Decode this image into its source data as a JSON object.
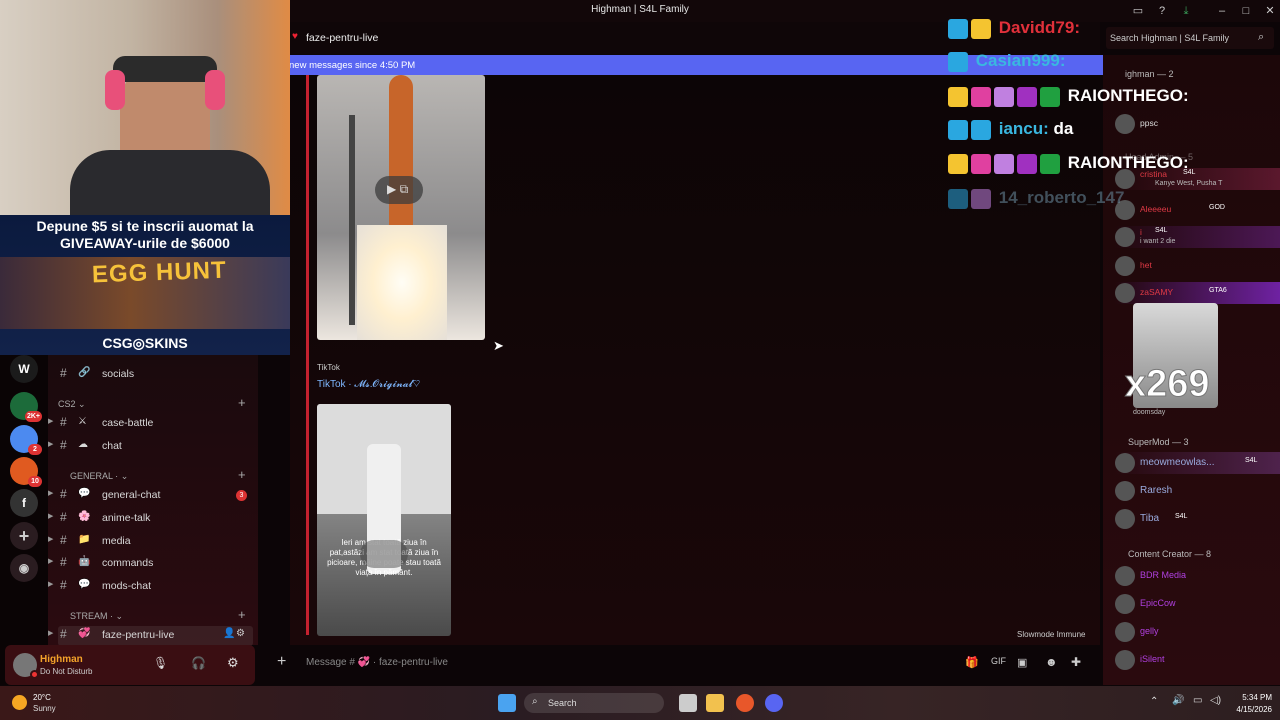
{
  "window": {
    "title": "Highman | S4L Family"
  },
  "promo": {
    "line1": "Depune $5 si te inscrii auomat la",
    "line2": "GIVEAWAY-urile de $6000",
    "event": "EGG HUNT",
    "brand": "CSG◎SKINS"
  },
  "chat_header": {
    "channel": "faze-pentru-live",
    "search_placeholder": "Search Highman | S4L Family"
  },
  "new_messages": {
    "text": "new messages since 4:50 PM"
  },
  "embed": {
    "provider": "TikTok",
    "author": "TikTok · 𝓜𝓼.𝓞𝓻𝓲𝓰𝓲𝓷𝓪𝓵♡",
    "caption": "Ieri am stat toată ziua în pat,astăzi am stat toată ziua în picioare, mâine poate stau toată viața în pământ."
  },
  "servers": [
    {
      "letter": "W",
      "badge": ""
    },
    {
      "letter": "",
      "badge": "2K+"
    },
    {
      "letter": "",
      "badge": "2"
    },
    {
      "letter": "",
      "badge": "10"
    },
    {
      "letter": "f",
      "badge": ""
    }
  ],
  "channels": {
    "top": [
      {
        "emoji": "🔗",
        "name": "socials"
      }
    ],
    "cat_cs2": "CS2",
    "cs2": [
      {
        "emoji": "⚔",
        "name": "case-battle"
      },
      {
        "emoji": "☁",
        "name": "chat"
      }
    ],
    "cat_general": "GENERAL ·",
    "general": [
      {
        "emoji": "💬",
        "name": "general-chat",
        "badge": "3"
      },
      {
        "emoji": "🌸",
        "name": "anime-talk",
        "badge": ""
      },
      {
        "emoji": "📁",
        "name": "media",
        "badge": ""
      },
      {
        "emoji": "🤖",
        "name": "commands",
        "badge": ""
      },
      {
        "emoji": "💬",
        "name": "mods-chat",
        "badge": ""
      }
    ],
    "cat_stream": "STREAM ·",
    "stream": [
      {
        "emoji": "💞",
        "name": "faze-pentru-live"
      }
    ]
  },
  "user": {
    "name": "Highman",
    "status": "Do Not Disturb"
  },
  "composer": {
    "placeholder": "Message # 💞 · faze-pentru-live",
    "slowmode": "Slowmode Immune"
  },
  "overlay_chat": [
    {
      "name": "Davidd79:",
      "text": "",
      "color": "#e0303a"
    },
    {
      "name": "Casian999:",
      "text": "",
      "color": "#3ab7e0"
    },
    {
      "name": "RAIONTHEGO:",
      "text": "",
      "color": "#ffffff"
    },
    {
      "name": "iancu:",
      "text": "da",
      "color": "#3ab7e0"
    },
    {
      "name": "RAIONTHEGO:",
      "text": "",
      "color": "#ffffff"
    },
    {
      "name": "14_roberto_147",
      "text": "",
      "color": "#6a8da0"
    }
  ],
  "members": {
    "sec_highman": "ighman — 2",
    "ppsc": "ppsc",
    "sec_head": "Head Admin — 5",
    "head": [
      {
        "name": "cristina",
        "tag": "S4L",
        "sub": "Kanye West, Pusha T",
        "color": "#e03a45"
      },
      {
        "name": "Aleeeeu",
        "tag": "GOD",
        "sub": "",
        "color": "#e03a45"
      },
      {
        "name": "i",
        "tag": "S4L",
        "sub": "i want 2 die",
        "color": "#e03a45"
      },
      {
        "name": "het",
        "tag": "",
        "sub": "",
        "color": "#e03a45"
      },
      {
        "name": "zaSAMY",
        "tag": "GTA6",
        "sub": "",
        "color": "#e03a45"
      }
    ],
    "doomsday": "doomsday",
    "x269": "x269",
    "sec_super": "SuperMod — 3",
    "super": [
      {
        "name": "meowmeowlas...",
        "tag": "S4L",
        "color": "#9ad"
      },
      {
        "name": "Raresh",
        "tag": "",
        "color": "#9ad"
      },
      {
        "name": "Tiba",
        "tag": "S4L",
        "color": "#9ad"
      }
    ],
    "sec_creator": "Content Creator — 8",
    "creator": [
      {
        "name": "BDR Media",
        "color": "#b040e0"
      },
      {
        "name": "EpicCow",
        "color": "#b040e0"
      },
      {
        "name": "gelly",
        "color": "#b040e0"
      },
      {
        "name": "iSilent",
        "color": "#b040e0"
      }
    ]
  },
  "taskbar": {
    "temp": "20°C",
    "weather": "Sunny",
    "search": "Search",
    "time": "5:34 PM",
    "date": "4/15/2026"
  }
}
